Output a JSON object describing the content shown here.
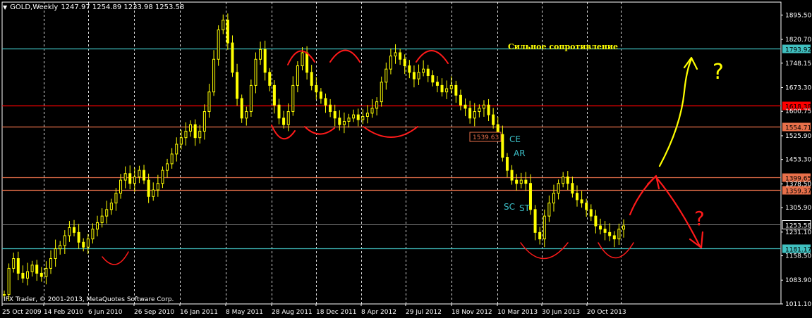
{
  "header": {
    "symbol": "GOLD,Weekly",
    "ohlc": "1247.97 1254.89 1233.98 1253.58"
  },
  "footer": {
    "copyright": "IFX Trader, © 2001-2013, MetaQuotes Software Corp."
  },
  "annotation_text": "Сильное сопротивление",
  "colors": {
    "background": "#000000",
    "candles": "#ffff00",
    "grid": "#ffffff",
    "red_line": "#ff0000",
    "orange_line": "#e8704a",
    "teal_line": "#40c0c0",
    "drawing_red": "#ff1a1a",
    "drawing_yellow": "#ffff00"
  },
  "chart_data": {
    "type": "candlestick",
    "title": "GOLD,Weekly",
    "ylim": [
      1011.1,
      1935.0
    ],
    "y_ticks": [
      "1895.50",
      "1820.70",
      "1748.15",
      "1673.30",
      "1600.75",
      "1525.90",
      "1453.30",
      "1378.50",
      "1305.90",
      "1231.10",
      "1158.50",
      "1083.90",
      "1011.10"
    ],
    "x_ticks": [
      "25 Oct 2009",
      "14 Feb 2010",
      "6 Jun 2010",
      "26 Sep 2010",
      "16 Jan 2011",
      "8 May 2011",
      "28 Aug 2011",
      "18 Dec 2011",
      "8 Apr 2012",
      "29 Jul 2012",
      "18 Nov 2012",
      "10 Mar 2013",
      "30 Jun 2013",
      "20 Oct 2013"
    ],
    "current_price": "1253.58",
    "price_series": [
      1040,
      1120,
      1150,
      1105,
      1090,
      1110,
      1130,
      1105,
      1095,
      1120,
      1150,
      1180,
      1190,
      1220,
      1245,
      1230,
      1200,
      1185,
      1210,
      1240,
      1260,
      1280,
      1300,
      1320,
      1350,
      1390,
      1410,
      1380,
      1400,
      1420,
      1390,
      1340,
      1360,
      1380,
      1420,
      1440,
      1470,
      1500,
      1520,
      1540,
      1560,
      1520,
      1540,
      1600,
      1660,
      1760,
      1850,
      1880,
      1810,
      1720,
      1640,
      1580,
      1600,
      1680,
      1760,
      1790,
      1720,
      1680,
      1620,
      1580,
      1560,
      1600,
      1680,
      1740,
      1780,
      1720,
      1680,
      1660,
      1640,
      1620,
      1600,
      1580,
      1560,
      1570,
      1580,
      1590,
      1575,
      1585,
      1595,
      1610,
      1630,
      1690,
      1730,
      1770,
      1780,
      1760,
      1740,
      1720,
      1700,
      1720,
      1730,
      1710,
      1690,
      1680,
      1660,
      1670,
      1680,
      1650,
      1620,
      1610,
      1580,
      1600,
      1610,
      1620,
      1590,
      1560,
      1530,
      1460,
      1420,
      1390,
      1380,
      1390,
      1380,
      1300,
      1230,
      1210,
      1280,
      1320,
      1350,
      1380,
      1400,
      1380,
      1350,
      1330,
      1320,
      1300,
      1280,
      1250,
      1240,
      1230,
      1220,
      1210,
      1240,
      1250
    ],
    "horizontal_lines": [
      {
        "price": 1793.92,
        "label": "1793.92",
        "color": "#40c0c0",
        "label_bg": "#40c0c0"
      },
      {
        "price": 1618.38,
        "label": "1618.38",
        "color": "#ff0000",
        "label_bg": "#ff0000"
      },
      {
        "price": 1554.71,
        "label": "1554.71",
        "color": "#e8704a",
        "label_bg": "#e8704a"
      },
      {
        "price": 1399.65,
        "label": "1399.65",
        "color": "#e8704a",
        "label_bg": "#e8704a"
      },
      {
        "price": 1359.37,
        "label": "1359.37",
        "color": "#e8704a",
        "label_bg": "#e8704a"
      },
      {
        "price": 1181.17,
        "label": "1181.17",
        "color": "#40c0c0",
        "label_bg": "#40c0c0"
      }
    ],
    "price_tag_label": "1539.63",
    "wyckoff_labels": [
      "CE",
      "AR",
      "SC",
      "ST"
    ],
    "question_marks": [
      "?",
      "?"
    ]
  }
}
